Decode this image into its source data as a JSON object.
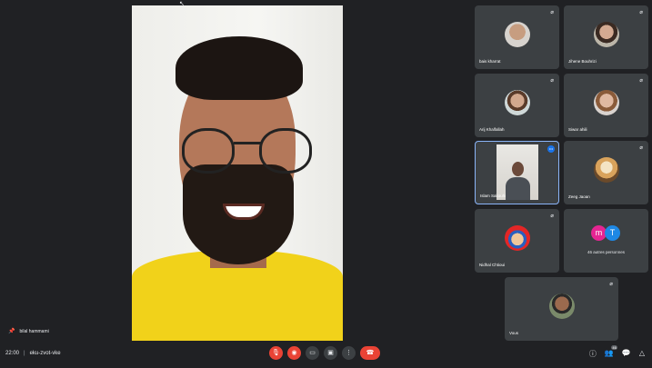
{
  "main_video": {
    "pinned_name": "bilal hammami"
  },
  "participants": [
    {
      "name": "bais kharrat",
      "avatar": "portrait-avatar"
    },
    {
      "name": "Jihene Bouhrizi",
      "avatar": "portrait-avatar"
    },
    {
      "name": "Arij Khalfallah",
      "avatar": "portrait-avatar"
    },
    {
      "name": "Siwar ahili",
      "avatar": "portrait-avatar"
    },
    {
      "name": "Islam Sakouhi",
      "avatar": "live-video",
      "speaking": true
    },
    {
      "name": "Zeeg Jaoan",
      "avatar": "bear-avatar"
    },
    {
      "name": "Nidhal Chtioui",
      "avatar": "mario-avatar"
    },
    {
      "name": "Vous",
      "avatar": "portrait-avatar"
    }
  ],
  "others_tile": {
    "initial_1": "m",
    "initial_2": "T",
    "label": "46 autres personnes"
  },
  "bottom_bar": {
    "time": "22:00",
    "separator": "|",
    "meeting_code": "eku-zvot-vke",
    "participants_count": "46"
  },
  "icons": {
    "mic": "mic-off-icon",
    "pin": "pin-icon",
    "camera": "camera-off-icon",
    "captions": "captions-icon",
    "present": "present-icon",
    "more": "more-icon",
    "hangup": "hangup-icon",
    "info": "info-icon",
    "people": "people-icon",
    "chat": "chat-icon",
    "activities": "activities-icon"
  },
  "colors": {
    "background": "#202124",
    "tile": "#3c4043",
    "accent": "#8ab4f8",
    "danger": "#ea4335"
  }
}
